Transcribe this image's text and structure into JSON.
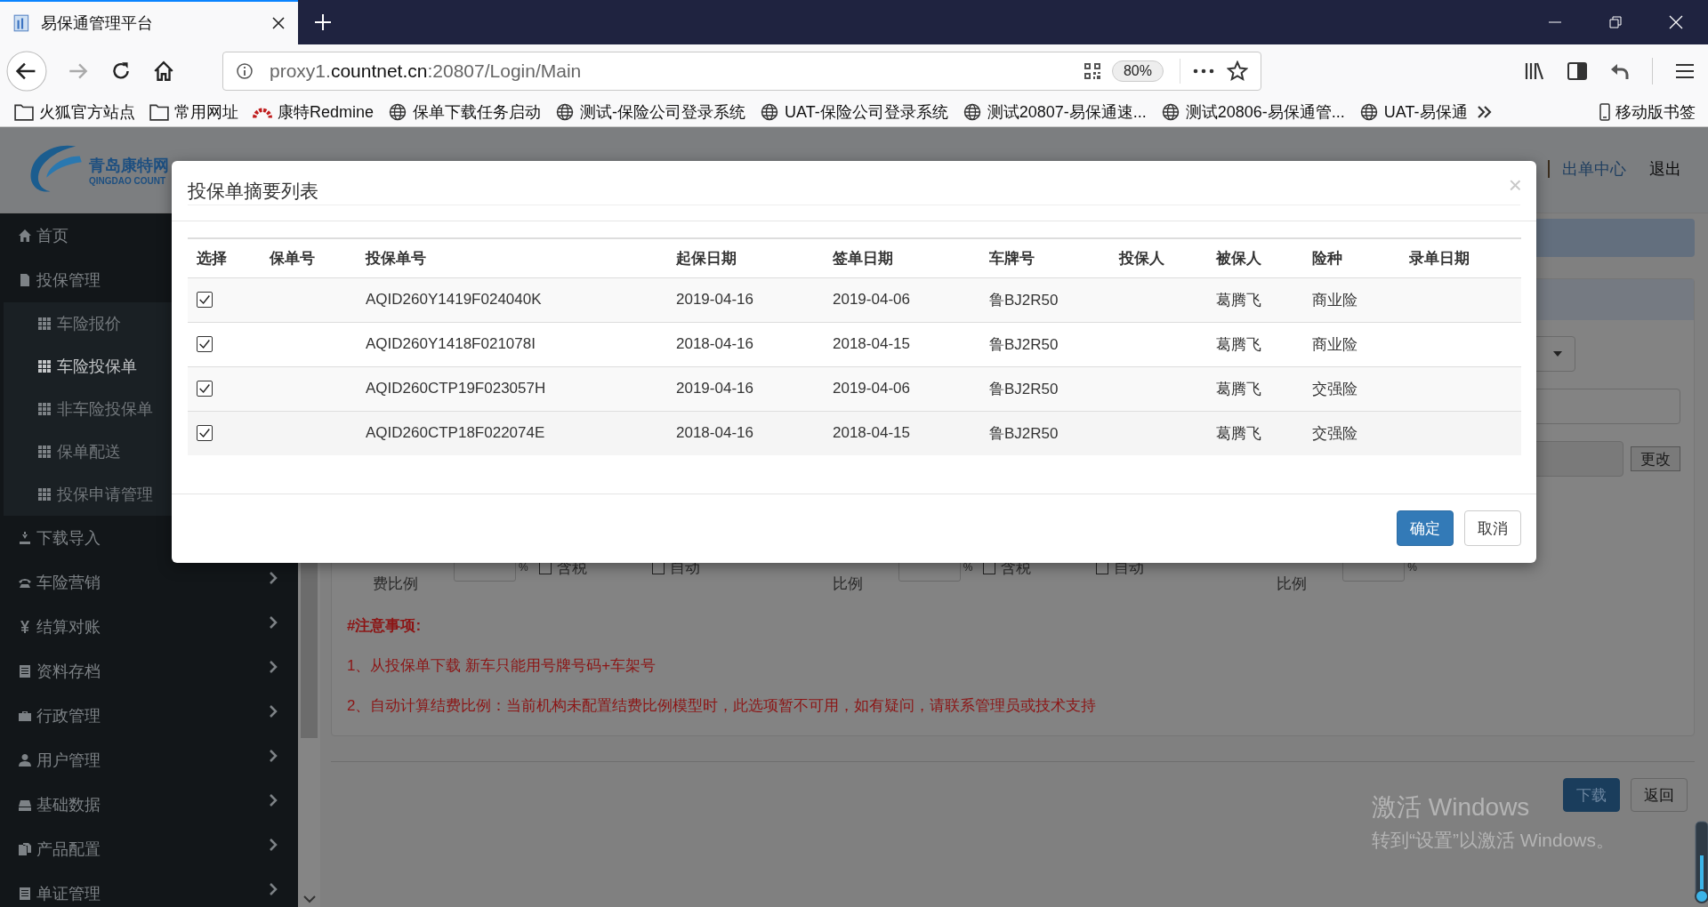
{
  "browser": {
    "tab": {
      "title": "易保通管理平台"
    },
    "url": {
      "prefix": "proxy1.",
      "domain": "countnet.cn",
      "path": ":20807/Login/Main"
    },
    "zoom": "80%",
    "bookmarks": [
      {
        "label": "火狐官方站点",
        "kind": "folder"
      },
      {
        "label": "常用网址",
        "kind": "folder"
      },
      {
        "label": "康特Redmine",
        "kind": "redmine"
      },
      {
        "label": "保单下载任务启动",
        "kind": "globe"
      },
      {
        "label": "测试-保险公司登录系统",
        "kind": "globe"
      },
      {
        "label": "UAT-保险公司登录系统",
        "kind": "globe"
      },
      {
        "label": "测试20807-易保通速...",
        "kind": "globe"
      },
      {
        "label": "测试20806-易保通管...",
        "kind": "globe"
      },
      {
        "label": "UAT-易保通",
        "kind": "globe"
      }
    ],
    "mobile_bookmarks": {
      "label": "移动版书签"
    }
  },
  "header": {
    "brand": {
      "name": "青岛康特网",
      "subtitle": "QINGDAO COUNT"
    },
    "links": [
      {
        "label": "出单中心",
        "kind": "link"
      },
      {
        "label": "退出",
        "kind": "plain"
      }
    ]
  },
  "sidebar": {
    "items": [
      {
        "label": "首页"
      },
      {
        "label": "投保管理",
        "expanded": true,
        "children": [
          {
            "label": "车险报价",
            "selected": false
          },
          {
            "label": "车险投保单",
            "selected": true
          },
          {
            "label": "非车险投保单",
            "selected": false
          },
          {
            "label": "保单配送",
            "selected": false
          },
          {
            "label": "投保申请管理",
            "selected": false
          }
        ]
      },
      {
        "label": "下载导入"
      },
      {
        "label": "车险营销",
        "expanded": false
      },
      {
        "label": "结算对账",
        "expanded": false
      },
      {
        "label": "资料存档",
        "expanded": false
      },
      {
        "label": "行政管理",
        "expanded": false
      },
      {
        "label": "用户管理",
        "expanded": false
      },
      {
        "label": "基础数据",
        "expanded": false
      },
      {
        "label": "产品配置",
        "expanded": false
      },
      {
        "label": "单证管理",
        "expanded": false
      }
    ]
  },
  "form": {
    "change_button": "更改",
    "fee_groups": [
      {
        "label": "费比例",
        "unit": "%",
        "options": [
          {
            "label": "含税",
            "checked": false
          },
          {
            "label": "自动",
            "checked": false
          }
        ]
      },
      {
        "label": "比例",
        "unit": "%",
        "options": [
          {
            "label": "含税",
            "checked": false
          },
          {
            "label": "自动",
            "checked": false
          }
        ]
      },
      {
        "label": "比例",
        "unit": "%"
      }
    ],
    "notes": {
      "title": "#注意事项:",
      "items": [
        "1、从投保单下载 新车只能用号牌号码+车架号",
        "2、自动计算结费比例：当前机构未配置结费比例模型时，此选项暂不可用，如有疑问，请联系管理员或技术支持"
      ]
    },
    "actions": [
      {
        "label": "下载",
        "kind": "primary"
      },
      {
        "label": "返回",
        "kind": "default"
      }
    ]
  },
  "modal": {
    "title": "投保单摘要列表",
    "close": "×",
    "columns": [
      "选择",
      "保单号",
      "投保单号",
      "起保日期",
      "签单日期",
      "车牌号",
      "投保人",
      "被保人",
      "险种",
      "录单日期"
    ],
    "rows": [
      {
        "checked": true,
        "application_no": "AQID260Y1419F024040K",
        "start_date": "2019-04-16",
        "sign_date": "2019-04-06",
        "plate": "鲁BJ2R50",
        "insured": "葛腾飞",
        "insurance_type": "商业险"
      },
      {
        "checked": true,
        "application_no": "AQID260Y1418F021078I",
        "start_date": "2018-04-16",
        "sign_date": "2018-04-15",
        "plate": "鲁BJ2R50",
        "insured": "葛腾飞",
        "insurance_type": "商业险"
      },
      {
        "checked": true,
        "application_no": "AQID260CTP19F023057H",
        "start_date": "2019-04-16",
        "sign_date": "2019-04-06",
        "plate": "鲁BJ2R50",
        "insured": "葛腾飞",
        "insurance_type": "交强险"
      },
      {
        "checked": true,
        "application_no": "AQID260CTP18F022074E",
        "start_date": "2018-04-16",
        "sign_date": "2018-04-15",
        "plate": "鲁BJ2R50",
        "insured": "葛腾飞",
        "insurance_type": "交强险"
      }
    ],
    "buttons": [
      {
        "label": "确定",
        "kind": "primary"
      },
      {
        "label": "取消",
        "kind": "default"
      }
    ]
  },
  "os_notice": {
    "title": "激活 Windows",
    "text": "转到“设置”以激活 Windows。"
  }
}
